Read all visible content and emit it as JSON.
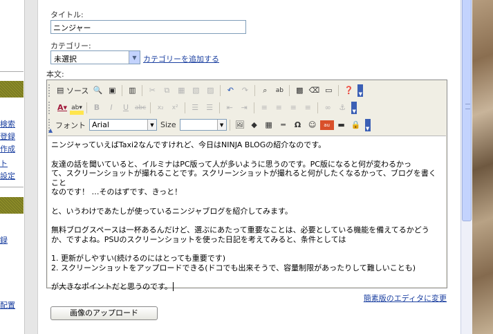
{
  "sidebar": {
    "links": [
      "検索",
      "登録",
      "作成",
      "ト",
      "設定",
      "録",
      "配置"
    ]
  },
  "form": {
    "title_label": "タイトル:",
    "title_value": "ニンジャー",
    "category_label": "カテゴリー:",
    "category_value": "未選択",
    "category_add_link": "カテゴリーを追加する",
    "body_label": "本文:"
  },
  "toolbar": {
    "source": "ソース",
    "font_label": "フォント",
    "font_value": "Arial",
    "size_label": "Size",
    "size_value": ""
  },
  "content": {
    "lines": [
      "ニンジャっていえばTaxi2なんですけれど、今日はNINJA BLOGの紹介なのです。",
      "",
      "友達の話を聞いていると、イルミナはPC版って人が多いように思うのです。PC版になると何が変わるかっ",
      "て、スクリーンショットが撮れることです。スクリーンショットが撮れると何がしたくなるかって、ブログを書くこと",
      "なのです！ …そのはずです、きっと！",
      "",
      "と、いうわけであたしが使っているニンジャブログを紹介してみます。",
      "",
      "無料ブログスペースは一杯あるんだけど、選ぶにあたって重要なことは、必要としている機能を備えてるかどう",
      "か、ですよね。PSUのスクリーンショットを使った日記を考えてみると、条件としては",
      "",
      "1. 更新がしやすい(続けるのにはとっても重要です)",
      "2. スクリーンショットをアップロードできる(ドコでも出来そうで、容量制限があったりして難しいことも)",
      "",
      "が大きなポイントだと思うのです。"
    ]
  },
  "footer": {
    "simple_editor_link": "簡素版のエディタに変更",
    "upload_button": "画像のアップロード"
  }
}
